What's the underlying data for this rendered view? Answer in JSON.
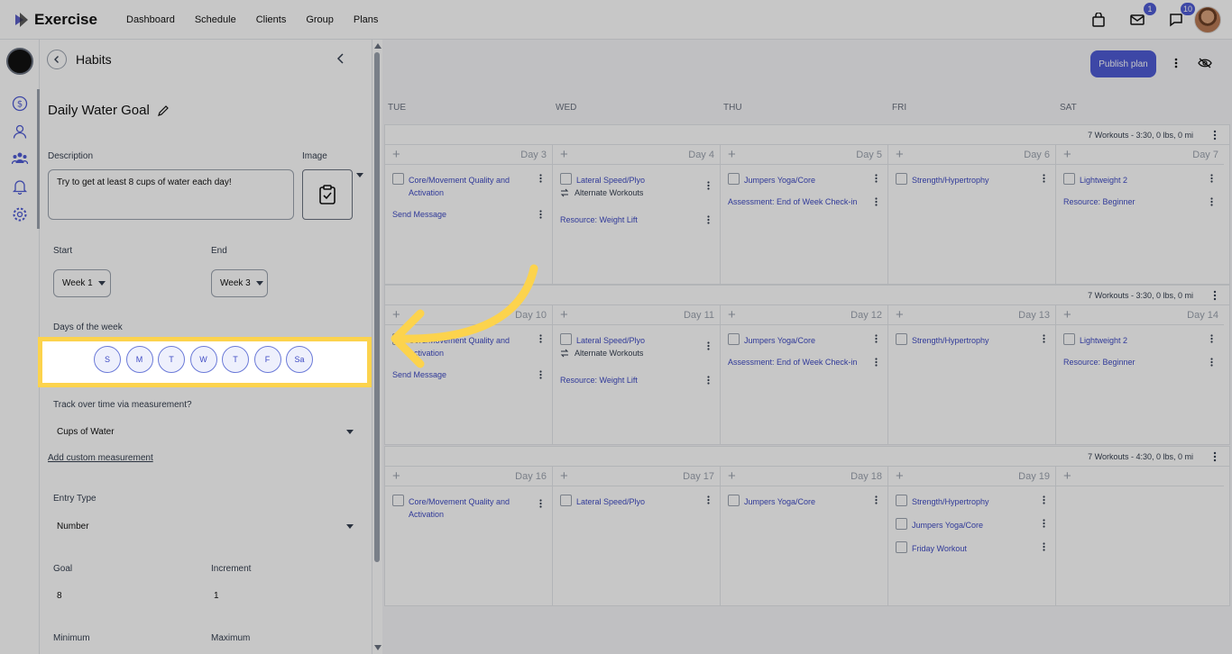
{
  "brand": "Exercise",
  "nav": [
    "Dashboard",
    "Schedule",
    "Clients",
    "Group",
    "Plans"
  ],
  "badges": {
    "mail": "1",
    "messages": "10"
  },
  "panel": {
    "title": "Habits",
    "habit_name": "Daily Water Goal",
    "description_label": "Description",
    "description_value": "Try to get at least 8 cups of water each day!",
    "image_label": "Image",
    "start_label": "Start",
    "start_value": "Week 1",
    "end_label": "End",
    "end_value": "Week 3",
    "days_label": "Days of the week",
    "days": [
      "S",
      "M",
      "T",
      "W",
      "T",
      "F",
      "Sa"
    ],
    "track_label": "Track over time via measurement?",
    "track_value": "Cups of Water",
    "custom_link": "Add custom measurement",
    "entry_label": "Entry Type",
    "entry_value": "Number",
    "goal_label": "Goal",
    "goal_value": "8",
    "increment_label": "Increment",
    "increment_value": "1",
    "minimum_label": "Minimum",
    "maximum_label": "Maximum"
  },
  "calendar": {
    "publish_label": "Publish plan",
    "day_headers": [
      "TUE",
      "WED",
      "THU",
      "FRI",
      "SAT"
    ],
    "weeks": [
      {
        "summary": "7 Workouts - 3:30, 0 lbs, 0 mi",
        "days": [
          "Day 3",
          "Day 4",
          "Day 5",
          "Day 6",
          "Day 7"
        ],
        "c0": {
          "w1": "Core/Movement Quality and Activation",
          "msg": "Send Message"
        },
        "c1": {
          "w1": "Lateral Speed/Plyo",
          "alt": "Alternate Workouts",
          "res": "Resource: Weight Lift"
        },
        "c2": {
          "w1": "Jumpers Yoga/Core",
          "res": "Assessment: End of Week Check-in"
        },
        "c3": {
          "w1": "Strength/Hypertrophy"
        },
        "c4": {
          "w1": "Lightweight 2",
          "res": "Resource: Beginner"
        }
      },
      {
        "summary": "7 Workouts - 3:30, 0 lbs, 0 mi",
        "days": [
          "Day 10",
          "Day 11",
          "Day 12",
          "Day 13",
          "Day 14"
        ],
        "c0": {
          "w1": "Core/Movement Quality and Activation",
          "msg": "Send Message"
        },
        "c1": {
          "w1": "Lateral Speed/Plyo",
          "alt": "Alternate Workouts",
          "res": "Resource: Weight Lift"
        },
        "c2": {
          "w1": "Jumpers Yoga/Core",
          "res": "Assessment: End of Week Check-in"
        },
        "c3": {
          "w1": "Strength/Hypertrophy"
        },
        "c4": {
          "w1": "Lightweight 2",
          "res": "Resource: Beginner"
        }
      },
      {
        "summary": "7 Workouts - 4:30, 0 lbs, 0 mi",
        "days": [
          "Day 16",
          "Day 17",
          "Day 18",
          "Day 19",
          ""
        ],
        "c0": {
          "w1": "Core/Movement Quality and Activation"
        },
        "c1": {
          "w1": "Lateral Speed/Plyo"
        },
        "c2": {
          "w1": "Jumpers Yoga/Core"
        },
        "c3": {
          "w1": "Strength/Hypertrophy",
          "w2": "Jumpers Yoga/Core",
          "w3": "Friday Workout"
        },
        "c4": {}
      }
    ]
  },
  "colors": {
    "accent": "#4f5bd5",
    "highlight": "#fcd34d"
  }
}
